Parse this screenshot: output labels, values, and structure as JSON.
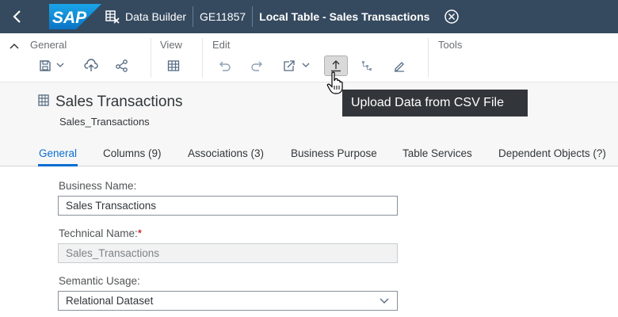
{
  "shellbar": {
    "logo_text": "SAP",
    "app_name": "Data Builder",
    "space": "GE11857",
    "title": "Local Table - Sales Transactions"
  },
  "toolbar": {
    "groups": {
      "general": "General",
      "view": "View",
      "edit": "Edit",
      "tools": "Tools"
    }
  },
  "tooltip": "Upload Data from CSV File",
  "header": {
    "title": "Sales Transactions",
    "subtitle": "Sales_Transactions"
  },
  "tabs": [
    {
      "label": "General"
    },
    {
      "label": "Columns (9)"
    },
    {
      "label": "Associations (3)"
    },
    {
      "label": "Business Purpose"
    },
    {
      "label": "Table Services"
    },
    {
      "label": "Dependent Objects (?)"
    }
  ],
  "form": {
    "business_name_label": "Business Name:",
    "business_name_value": "Sales Transactions",
    "technical_name_label": "Technical Name:",
    "technical_name_required": "*",
    "technical_name_value": "Sales_Transactions",
    "semantic_usage_label": "Semantic Usage:",
    "semantic_usage_value": "Relational Dataset"
  },
  "colors": {
    "shell": "#354a5f",
    "accent": "#0a6ed1",
    "tooltip": "#32363a"
  }
}
